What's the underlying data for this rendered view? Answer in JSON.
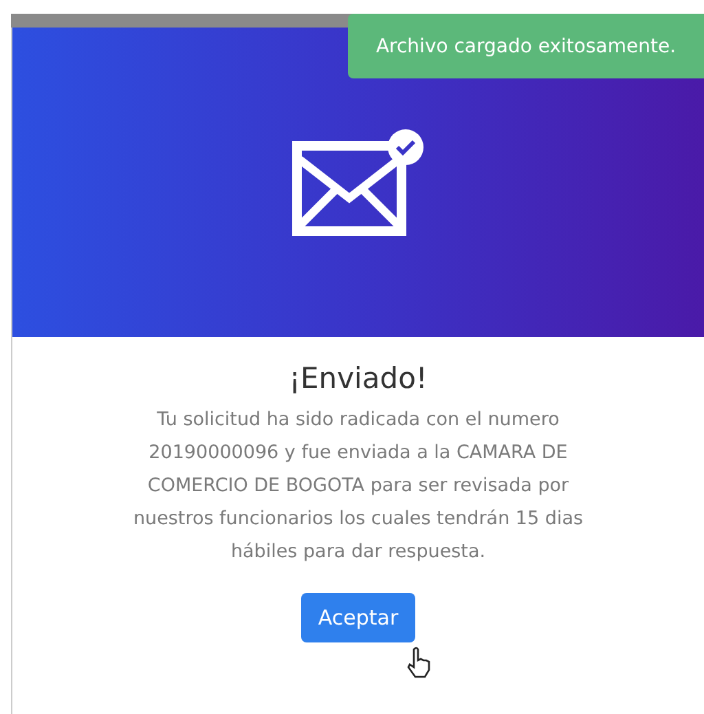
{
  "toast": {
    "message": "Archivo cargado exitosamente."
  },
  "dialog": {
    "title": "¡Enviado!",
    "message": "Tu solicitud ha sido radicada con el numero 20190000096 y fue enviada a la CAMARA DE COMERCIO DE BOGOTA para ser revisada por nuestros funcionarios los cuales tendrán 15 dias hábiles para dar respuesta.",
    "button": "Aceptar"
  }
}
